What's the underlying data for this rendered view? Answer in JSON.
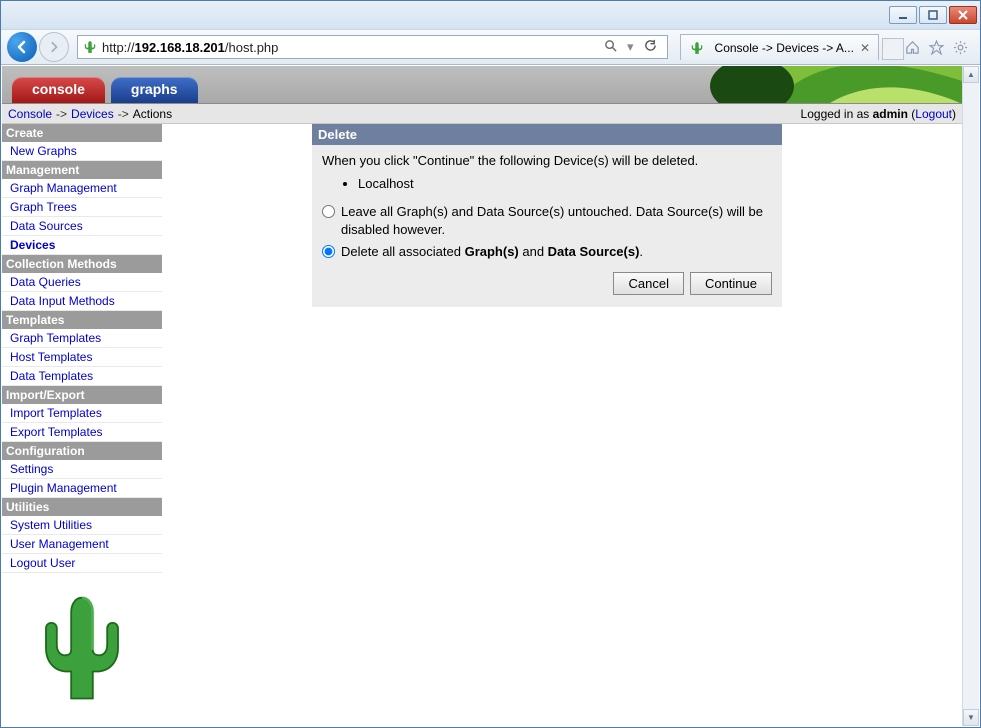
{
  "window": {
    "url_prefix": "http://",
    "url_host": "192.168.18.201",
    "url_path": "/host.php",
    "tab_title": "Console -> Devices -> A..."
  },
  "breadcrumb": {
    "console": "Console",
    "devices": "Devices",
    "actions": "Actions",
    "sep": "->",
    "login_prefix": "Logged in as ",
    "login_user": "admin",
    "logout_label": "Logout"
  },
  "tabs": {
    "console": "console",
    "graphs": "graphs"
  },
  "sidebar": {
    "sections": [
      {
        "title": "Create",
        "items": [
          "New Graphs"
        ]
      },
      {
        "title": "Management",
        "items": [
          "Graph Management",
          "Graph Trees",
          "Data Sources",
          "Devices"
        ]
      },
      {
        "title": "Collection Methods",
        "items": [
          "Data Queries",
          "Data Input Methods"
        ]
      },
      {
        "title": "Templates",
        "items": [
          "Graph Templates",
          "Host Templates",
          "Data Templates"
        ]
      },
      {
        "title": "Import/Export",
        "items": [
          "Import Templates",
          "Export Templates"
        ]
      },
      {
        "title": "Configuration",
        "items": [
          "Settings",
          "Plugin Management"
        ]
      },
      {
        "title": "Utilities",
        "items": [
          "System Utilities",
          "User Management",
          "Logout User"
        ]
      }
    ],
    "active": "Devices"
  },
  "panel": {
    "title": "Delete",
    "intro": "When you click \"Continue\" the following Device(s) will be deleted.",
    "devices": [
      "Localhost"
    ],
    "option1": "Leave all Graph(s) and Data Source(s) untouched. Data Source(s) will be disabled however.",
    "option2_pre": "Delete all associated ",
    "option2_b1": "Graph(s)",
    "option2_mid": " and ",
    "option2_b2": "Data Source(s)",
    "option2_post": ".",
    "selected_option": 2,
    "cancel": "Cancel",
    "continue": "Continue"
  }
}
